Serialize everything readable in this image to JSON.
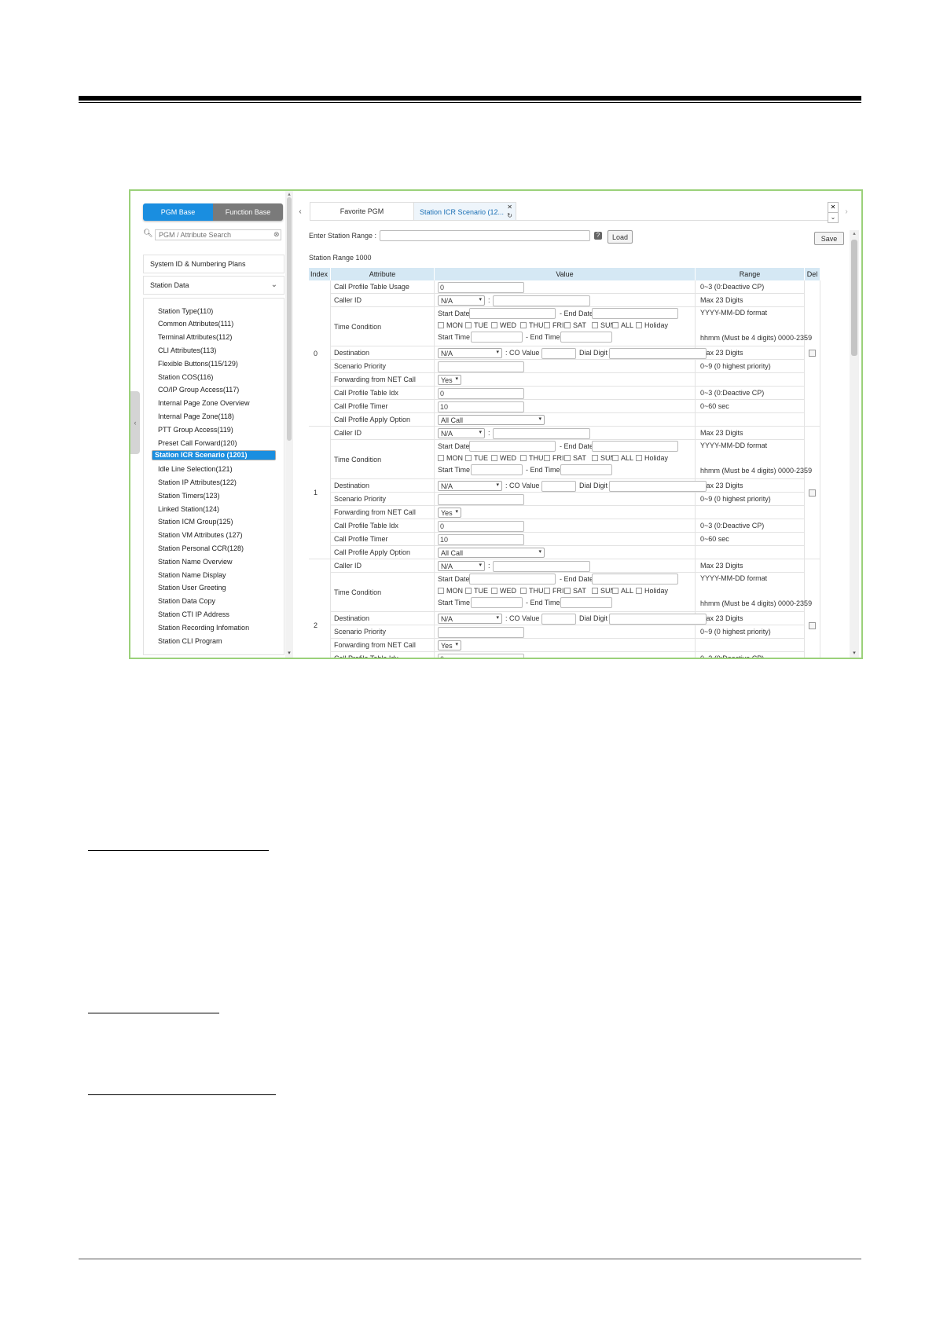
{
  "left_panel": {
    "tabs": [
      {
        "label": "PGM Base",
        "active": true
      },
      {
        "label": "Function Base",
        "active": false
      }
    ],
    "search_placeholder": "PGM / Attribute Search",
    "groups": [
      {
        "label": "System ID & Numbering Plans"
      },
      {
        "label": "Station Data"
      }
    ],
    "items": [
      "Station Type(110)",
      "Common Attributes(111)",
      "Terminal Attributes(112)",
      "CLI Attributes(113)",
      "Flexible Buttons(115/129)",
      "Station COS(116)",
      "CO/IP Group Access(117)",
      "Internal Page Zone Overview",
      "Internal Page Zone(118)",
      "PTT Group Access(119)",
      "Preset Call Forward(120)",
      "Station ICR Scenario (1201)",
      "Idle Line Selection(121)",
      "Station IP Attributes(122)",
      "Station Timers(123)",
      "Linked Station(124)",
      "Station ICM Group(125)",
      "Station VM Attributes (127)",
      "Station Personal CCR(128)",
      "Station Name Overview",
      "Station Name Display",
      "Station User Greeting",
      "Station Data Copy",
      "Station CTI IP Address",
      "Station Recording Infomation",
      "Station CLI Program"
    ],
    "selected_index": 11
  },
  "right_panel": {
    "tabs": [
      {
        "label": "Favorite PGM"
      },
      {
        "label": "Station ICR Scenario (12..."
      }
    ],
    "range_label": "Enter Station Range :",
    "load_label": "Load",
    "save_label": "Save",
    "station_range_label": "Station Range 1000",
    "columns": [
      "Index",
      "Attribute",
      "Value",
      "Range",
      "Del"
    ],
    "labels": {
      "start_date": "Start Date",
      "end_date": "- End Date",
      "start_time": "Start Time",
      "end_time": "- End Time",
      "co_value": ": CO Value",
      "dial_digit": "Dial Digit",
      "colon": ":",
      "days": [
        "MON",
        "TUE",
        "WED",
        "THU",
        "FRI",
        "SAT",
        "SUN",
        "ALL",
        "Holiday"
      ]
    },
    "attributes": {
      "call_profile_table_usage": "Call Profile Table Usage",
      "caller_id": "Caller ID",
      "time_condition": "Time Condition",
      "destination": "Destination",
      "scenario_priority": "Scenario Priority",
      "forwarding_from_net_call": "Forwarding from NET Call",
      "call_profile_table_idx": "Call Profile Table Idx",
      "call_profile_timer": "Call Profile Timer",
      "call_profile_apply_option": "Call Profile Apply Option"
    },
    "ranges": {
      "cp_usage": "0~3 (0:Deactive CP)",
      "caller_id": "Max 23 Digits",
      "date_format": "YYYY-MM-DD format",
      "time_format": "hhmm (Must be 4 digits) 0000-2359",
      "destination": "Max 23 Digits",
      "priority": "0~9 (0 highest priority)",
      "cp_idx": "0~3 (0:Deactive CP)",
      "timer": "0~60 sec"
    },
    "values": {
      "cp_usage": "0",
      "caller_id_select": "N/A",
      "destination_select": "N/A",
      "forwarding": "Yes",
      "cp_idx": "0",
      "timer": "10",
      "apply_option": "All Call"
    },
    "indices": [
      "0",
      "1",
      "2"
    ]
  }
}
